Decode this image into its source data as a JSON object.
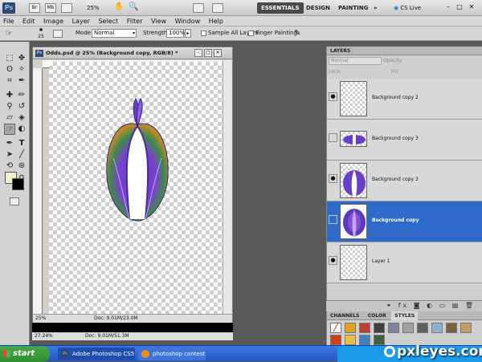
{
  "appbar": {
    "logo": "Ps",
    "zoom": "25%",
    "workspaces": [
      "ESSENTIALS",
      "DESIGN",
      "PAINTING"
    ],
    "more": "»",
    "cslive": "CS Live"
  },
  "menu": [
    "File",
    "Edit",
    "Image",
    "Layer",
    "Select",
    "Filter",
    "View",
    "Window",
    "Help"
  ],
  "options": {
    "brush_size": "25",
    "mode_label": "Mode:",
    "mode_value": "Normal",
    "strength_label": "Strength:",
    "strength_value": "100%",
    "sample_all_layers": "Sample All Layers",
    "finger_painting": "Finger Painting"
  },
  "document": {
    "title": "Odds.psd @ 25% (Background copy, RGB/8) *",
    "zoom": "25%",
    "doc_info": "Doc: 9.01M/23.0M"
  },
  "statusbar": {
    "zoom": "27.24%",
    "doc_info": "Doc: 9.01M/51.3M"
  },
  "layers_panel": {
    "tab": "LAYERS",
    "blend": "Normal",
    "opacity_label": "Opacity:",
    "lock_label": "Lock:",
    "fill_label": "Fill:",
    "layers": [
      {
        "name": "Background copy 2",
        "visible": true,
        "selected": false
      },
      {
        "name": "Background copy 3",
        "visible": false,
        "selected": false
      },
      {
        "name": "Background copy 3",
        "visible": true,
        "selected": false
      },
      {
        "name": "Background copy",
        "visible": false,
        "selected": true
      },
      {
        "name": "Layer 1",
        "visible": true,
        "selected": false
      }
    ]
  },
  "bottom_panel": {
    "tabs": [
      "CHANNELS",
      "COLOR",
      "STYLES"
    ]
  },
  "taskbar": {
    "start": "start",
    "items": [
      "Adobe Photoshop CS5",
      "photoshop contest o..."
    ]
  },
  "watermark": "pxleyes.com",
  "colors": {
    "accent": "#2f6ac8",
    "taskbar": "#2456c2",
    "start": "#3a9c3a",
    "purple": "#6a3fc8"
  }
}
